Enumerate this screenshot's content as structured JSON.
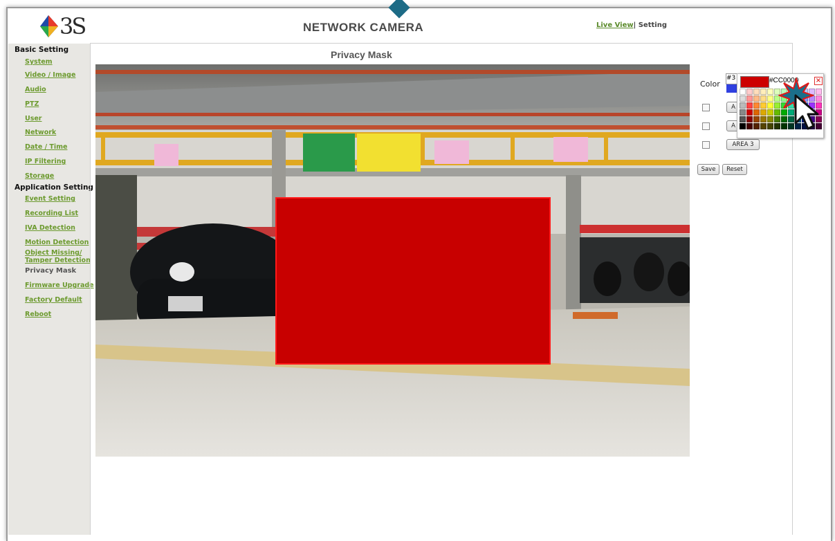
{
  "header": {
    "logo_text": "3S",
    "title": "NETWORK CAMERA",
    "live_view_link": "Live View",
    "separator": "|",
    "setting_label": "Setting"
  },
  "sidebar": {
    "basic_heading": "Basic Setting",
    "basic_items": [
      "System",
      "Video / Image",
      "Audio",
      "PTZ",
      "User",
      "Network",
      "Date / Time",
      "IP Filtering",
      "Storage"
    ],
    "app_heading": "Application Setting",
    "app_items": [
      "Event Setting",
      "Recording List",
      "IVA Detection",
      "Motion Detection",
      "Object Missing/",
      "Tamper Detection"
    ],
    "current_item": "Privacy Mask",
    "bottom_items": [
      "Firmware Upgrade",
      "Factory Default",
      "Reboot"
    ]
  },
  "main": {
    "page_title": "Privacy Mask",
    "mask_color": "#c80000"
  },
  "controls": {
    "color_label": "Color",
    "behind_value": "#3",
    "areas": [
      {
        "label": "A",
        "checked": false
      },
      {
        "label": "A",
        "checked": false
      },
      {
        "label": "AREA 3",
        "checked": false
      }
    ],
    "save_label": "Save",
    "reset_label": "Reset"
  },
  "color_picker": {
    "selected_color": "#cc0000",
    "hex_value": "#CC0000",
    "close_icon": "close-x-icon"
  }
}
